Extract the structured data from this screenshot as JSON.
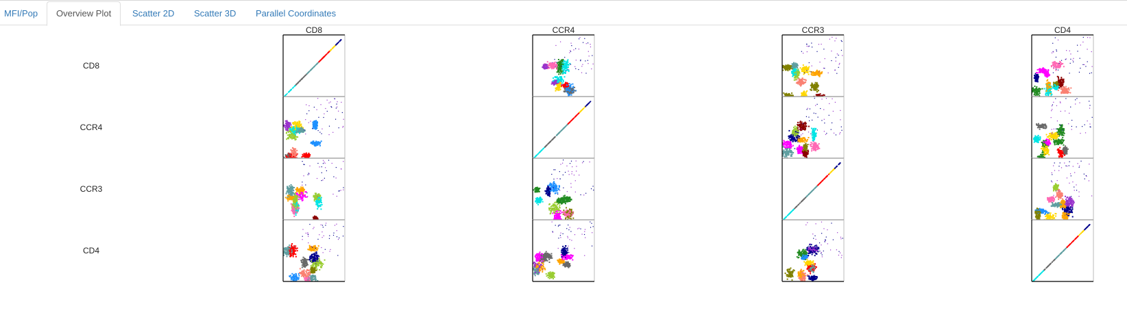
{
  "tabs": [
    {
      "label": "MFI/Pop",
      "active": false
    },
    {
      "label": "Overview Plot",
      "active": true
    },
    {
      "label": "Scatter 2D",
      "active": false
    },
    {
      "label": "Scatter 3D",
      "active": false
    },
    {
      "label": "Parallel Coordinates",
      "active": false
    }
  ],
  "markers": [
    "CD8",
    "CCR4",
    "CCR3",
    "CD4"
  ],
  "colors": {
    "link": "#337ab7",
    "active_tab_text": "#555555",
    "populations": [
      "#00e5e5",
      "#ff0000",
      "#5f9ea0",
      "#696969",
      "#9932cc",
      "#ffd700",
      "#228b22",
      "#fa8072",
      "#8b0000",
      "#00008b",
      "#ff69b4",
      "#9acd32",
      "#808000",
      "#ffa500",
      "#ff00ff",
      "#1e90ff"
    ]
  }
}
